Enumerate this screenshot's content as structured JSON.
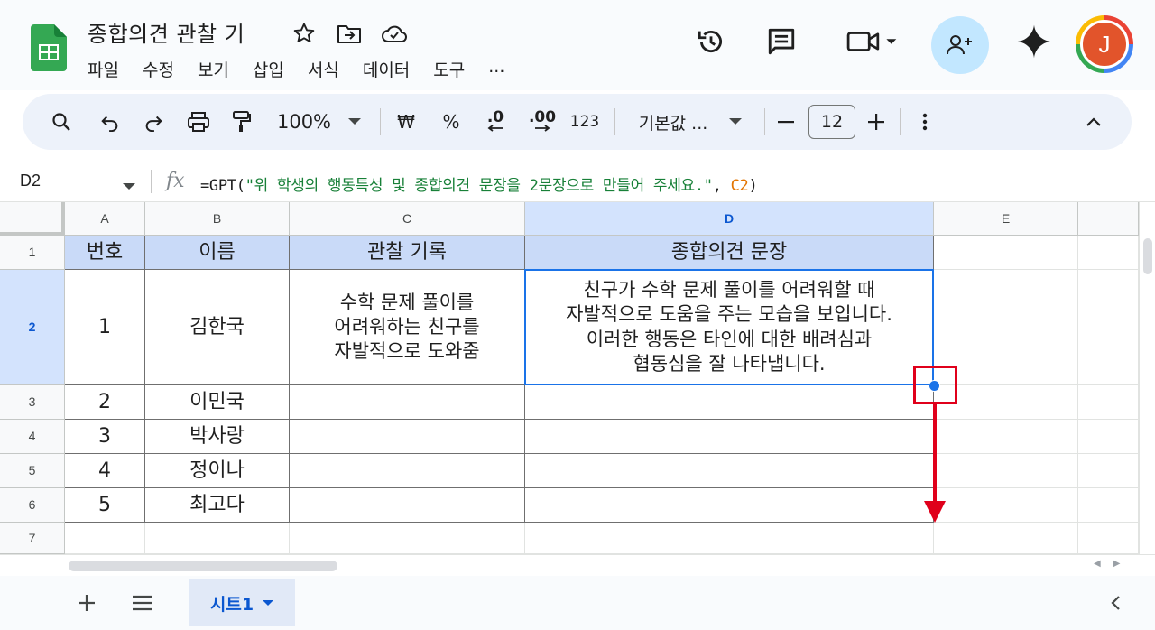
{
  "header": {
    "title": "종합의견 관찰 기",
    "menu": [
      "파일",
      "수정",
      "보기",
      "삽입",
      "서식",
      "데이터",
      "도구",
      "..."
    ],
    "avatar_letter": "J"
  },
  "toolbar": {
    "zoom": "100%",
    "currency": "₩",
    "percent": "%",
    "decrease_decimal": ".0",
    "increase_decimal": ".00",
    "number_format": "123",
    "font": "기본값 ...",
    "font_size": "12"
  },
  "formula_bar": {
    "name_box": "D2",
    "fx": "fx",
    "formula_prefix": "=GPT(",
    "formula_string": "\"위 학생의 행동특성 및 종합의견 문장을 2문장으로 만들어 주세요.\"",
    "formula_sep": ", ",
    "formula_ref": "C2",
    "formula_suffix": ")"
  },
  "grid": {
    "columns": [
      "A",
      "B",
      "C",
      "D",
      "E"
    ],
    "rows": [
      "1",
      "2",
      "3",
      "4",
      "5",
      "6",
      "7"
    ],
    "header_row": [
      "번호",
      "이름",
      "관찰 기록",
      "종합의견 문장"
    ],
    "data": [
      {
        "num": "1",
        "name": "김한국",
        "obs": "수학 문제 풀이를\n어려워하는 친구를\n자발적으로 도와줌",
        "opinion": "친구가 수학 문제 풀이를 어려워할 때\n자발적으로 도움을 주는 모습을 보입니다.\n이러한 행동은 타인에 대한 배려심과\n협동심을 잘 나타냅니다."
      },
      {
        "num": "2",
        "name": "이민국",
        "obs": "",
        "opinion": ""
      },
      {
        "num": "3",
        "name": "박사랑",
        "obs": "",
        "opinion": ""
      },
      {
        "num": "4",
        "name": "정이나",
        "obs": "",
        "opinion": ""
      },
      {
        "num": "5",
        "name": "최고다",
        "obs": "",
        "opinion": ""
      }
    ]
  },
  "sheets": {
    "active_tab": "시트1"
  },
  "colors": {
    "accent": "#1a73e8",
    "header_fill": "#c9daf8",
    "annotation": "#e0001b"
  }
}
